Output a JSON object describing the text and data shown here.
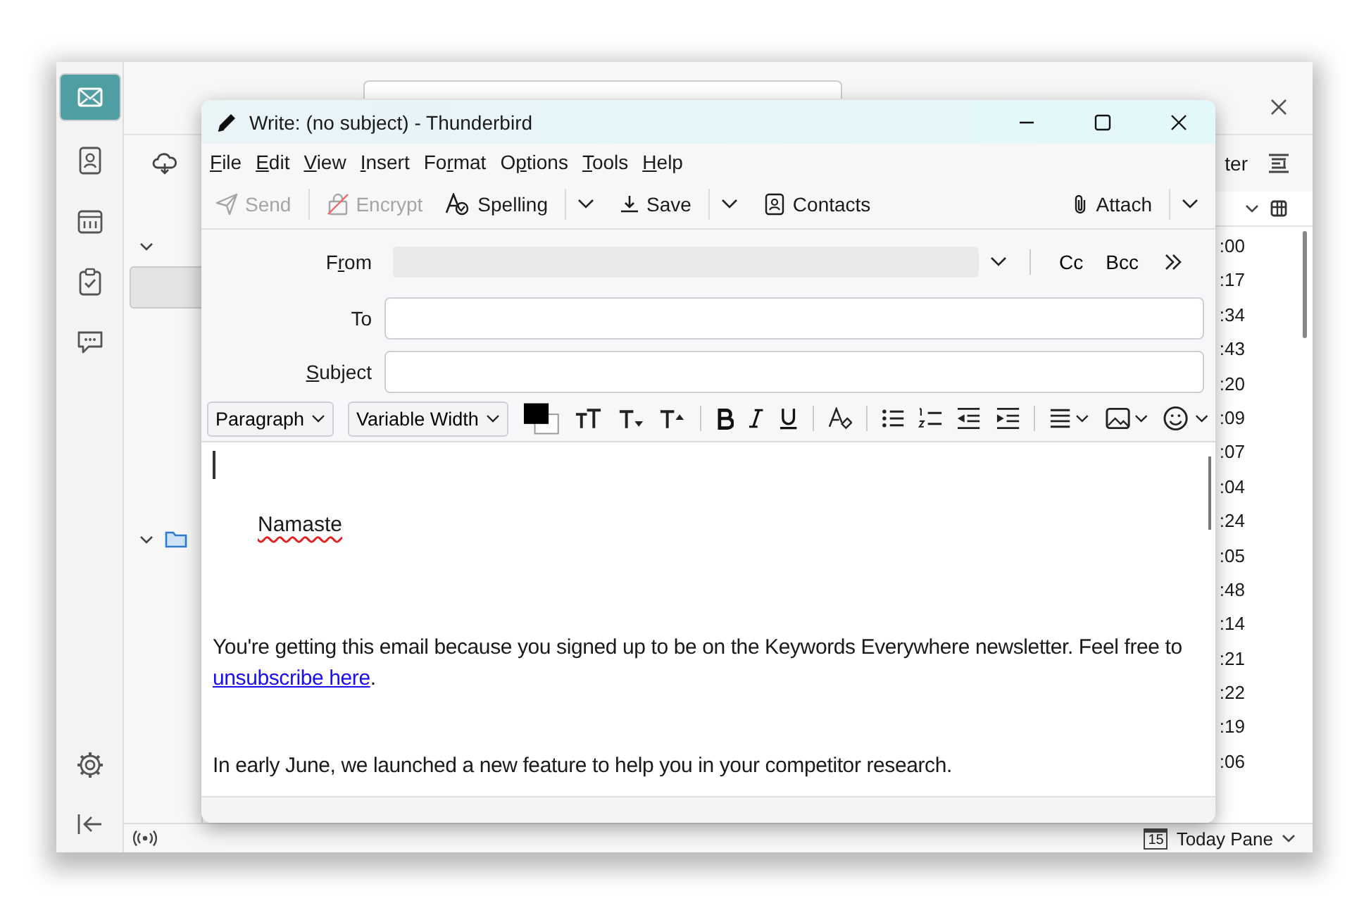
{
  "main_window": {
    "toolbar_fragment": "ter",
    "times": [
      ":00",
      ":17",
      ":34",
      ":43",
      ":20",
      ":09",
      ":07",
      ":04",
      ":24",
      ":05",
      ":48",
      ":14",
      ":21",
      ":22",
      ":19",
      ":06"
    ],
    "status_bar": {
      "calendar_day": "15",
      "today_pane": "Today Pane"
    }
  },
  "compose": {
    "title": "Write: (no subject) - Thunderbird",
    "menu": [
      {
        "key": "F",
        "after": "ile"
      },
      {
        "key": "E",
        "after": "dit"
      },
      {
        "key": "V",
        "after": "iew"
      },
      {
        "key": "I",
        "after": "nsert"
      },
      {
        "before": "Fo",
        "key": "r",
        "after": "mat"
      },
      {
        "before": "O",
        "key": "p",
        "after": "tions"
      },
      {
        "key": "T",
        "after": "ools"
      },
      {
        "key": "H",
        "after": "elp"
      }
    ],
    "toolbar": [
      {
        "kind": "send",
        "label": "Send",
        "disabled": true,
        "dropdown": false
      },
      {
        "kind": "encrypt",
        "label": "Encrypt",
        "disabled": true,
        "dropdown": false
      },
      {
        "kind": "spelling",
        "label": "Spelling",
        "disabled": false,
        "dropdown": true
      },
      {
        "kind": "save",
        "label": "Save",
        "disabled": false,
        "dropdown": true
      },
      {
        "kind": "contacts",
        "label": "Contacts",
        "disabled": false,
        "dropdown": false
      },
      {
        "kind": "attach",
        "label": "Attach",
        "disabled": false,
        "dropdown": true
      }
    ],
    "from": {
      "before": "F",
      "key": "r",
      "after": "om"
    },
    "to": {
      "label": "To"
    },
    "subject": {
      "key": "S",
      "after": "ubject"
    },
    "cc": "Cc",
    "bcc": "Bcc",
    "format": {
      "paragraph": "Paragraph",
      "font": "Variable Width"
    },
    "body": {
      "greeting": "Namaste",
      "greeting_misspelled": true,
      "paragraphs": [
        {
          "text": "You're getting this email because you signed up to be on the Keywords Everywhere newsletter. Feel free to ",
          "link": "unsubscribe here",
          "after": "."
        },
        {
          "text": "In early June, we launched a new feature to help you in your competitor research."
        }
      ]
    }
  }
}
